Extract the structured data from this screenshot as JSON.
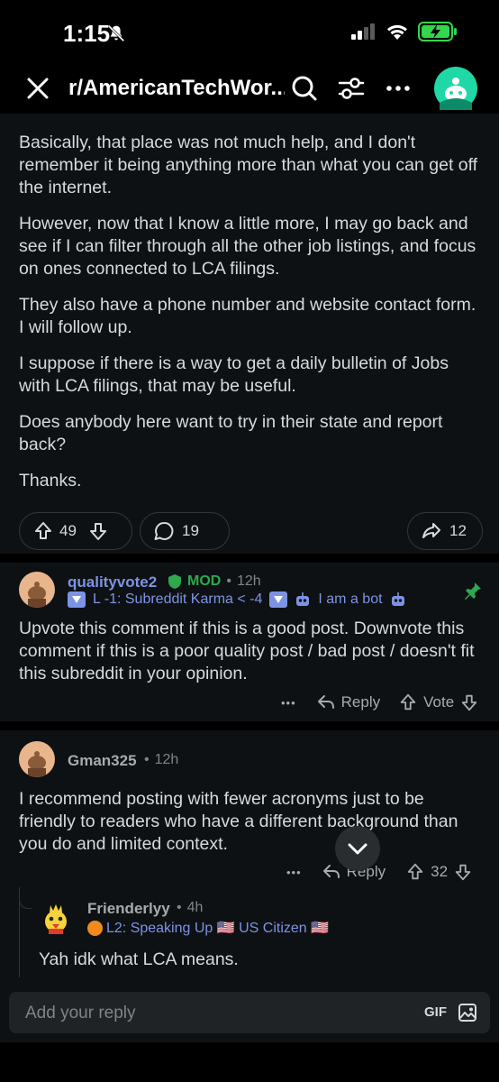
{
  "status_bar": {
    "time": "1:15",
    "battery_charging": true
  },
  "nav": {
    "title": "r/AmericanTechWor...",
    "accent": "#1fd8a5"
  },
  "post": {
    "paragraphs": [
      "Basically, that place was not much help, and I don't remember it being anything more than what you can get off the internet.",
      "However, now that I know a little more, I may go back and see if I can filter through all the other job listings, and focus on ones connected to LCA filings.",
      "They also have a phone number and website contact form. I will follow up.",
      "I suppose if there is a way to get a daily bulletin of Jobs with LCA filings, that may be useful.",
      "Does anybody here want to try in their state and report back?",
      "Thanks."
    ],
    "votes": "49",
    "comments": "19",
    "shares": "12"
  },
  "comments": [
    {
      "author": "qualityvote2",
      "mod_label": "MOD",
      "time": "12h",
      "flair_text_1": "L -1: Subreddit Karma < -4",
      "flair_text_2": "I am a bot",
      "body": "Upvote this comment if this is a good post. Downvote this comment if this is a poor quality post / bad post / doesn't fit this subreddit in your opinion.",
      "reply_label": "Reply",
      "vote_label": "Vote",
      "more": "•••",
      "pinned": true
    },
    {
      "author": "Gman325",
      "time": "12h",
      "body": "I recommend posting with fewer acronyms just to be friendly to readers who have a different background than you do and limited context.",
      "reply_label": "Reply",
      "votes": "32",
      "more": "•••"
    },
    {
      "author": "Frienderlyy",
      "time": "4h",
      "flair": "L2: Speaking Up 🇺🇸 US Citizen 🇺🇸",
      "body": "Yah idk what LCA means."
    }
  ],
  "meta_sep": "•",
  "reply_bar": {
    "placeholder": "Add your reply",
    "gif_label": "GIF"
  }
}
